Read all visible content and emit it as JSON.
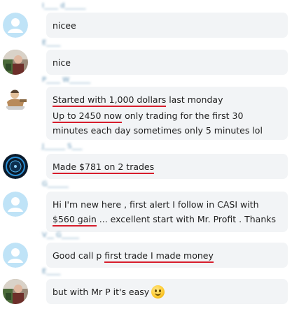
{
  "messages": [
    {
      "sender": "I____ d______",
      "avatar": "default-user-icon",
      "lines": [
        "nicee"
      ]
    },
    {
      "sender": "E____",
      "avatar": "photo-avatar",
      "lines": [
        "nice"
      ]
    },
    {
      "sender": "P____ W______",
      "avatar": "cartoon-avatar",
      "line1_a": "Started with 1,000 dollars",
      "line1_b": " last monday",
      "line2_a": "Up to 2450 now",
      "line2_b": " only trading for the first 30 minutes each day sometimes only 5 minutes lol"
    },
    {
      "sender": "J______ S___",
      "avatar": "logo-avatar",
      "line1": "Made $781 on 2 trades"
    },
    {
      "sender": "G______",
      "avatar": "default-user-icon",
      "line1": "Hi I'm new here , first alert I follow in CASI with ",
      "underlined": "$560 gain",
      "line1_end": " ... excellent start with Mr. Profit . Thanks"
    },
    {
      "sender": "V__ G_____",
      "avatar": "default-user-icon",
      "line_a": "Good call p ",
      "line_b": "first trade I made money"
    },
    {
      "sender": "E____",
      "avatar": "photo-avatar",
      "line": "but with Mr P it's easy",
      "emoji": "smiley-emoji-icon"
    }
  ],
  "colors": {
    "sender_name": "#2a7ab6",
    "bubble_bg": "#f2f4f6",
    "underline": "#d71d2c",
    "default_avatar": "#bfe3f7"
  }
}
